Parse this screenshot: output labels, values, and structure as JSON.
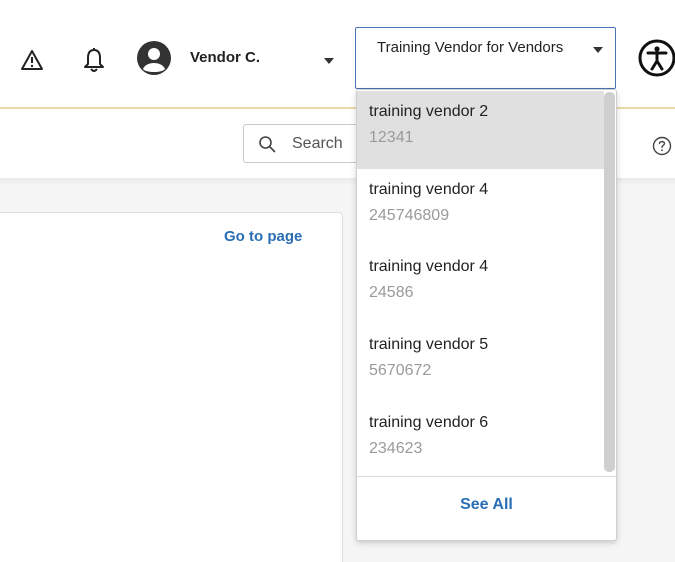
{
  "header": {
    "user_name": "Vendor C.",
    "vendor_select_value": "Training Vendor for Vendors"
  },
  "search": {
    "placeholder": "Search"
  },
  "content": {
    "go_to_page_link": "Go to page"
  },
  "vendor_dropdown": {
    "items": [
      {
        "name": "training vendor 2",
        "id": "12341"
      },
      {
        "name": "training vendor 4",
        "id": "245746809"
      },
      {
        "name": "training vendor 4",
        "id": "24586"
      },
      {
        "name": "training vendor 5",
        "id": "5670672"
      },
      {
        "name": "training vendor 6",
        "id": "234623"
      }
    ],
    "see_all_label": "See All"
  },
  "icons": [
    "warning-icon",
    "bell-icon",
    "user-avatar-icon",
    "chevron-down-icon",
    "accessibility-icon",
    "search-icon",
    "help-icon"
  ],
  "colors": {
    "accent": "#2a6fb5",
    "select_border": "#4a73b5",
    "header_line": "#e7d9a4",
    "selected_row": "#e0e0e0"
  }
}
